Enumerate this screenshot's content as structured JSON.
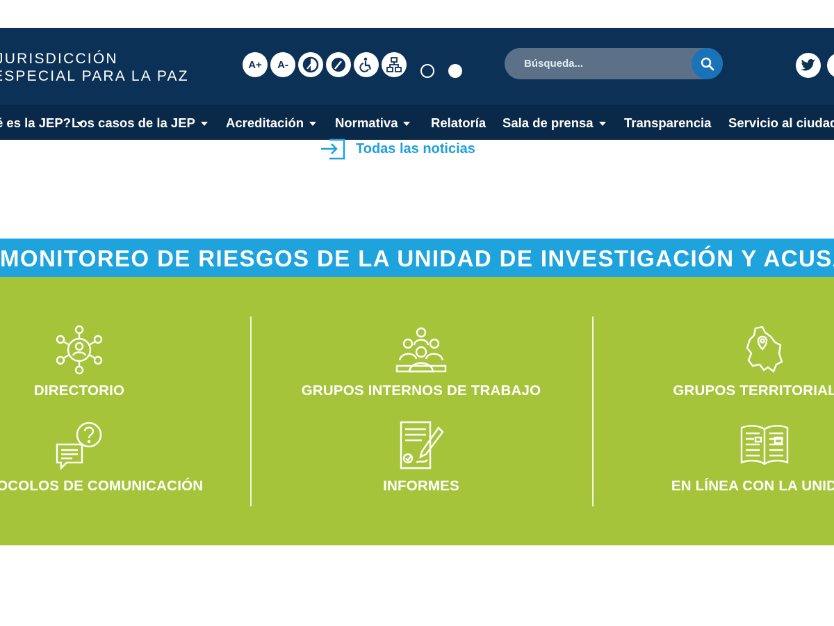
{
  "header": {
    "logo_line1": "JURISDICCIÓN",
    "logo_line2": "ESPECIAL PARA LA PAZ",
    "a11y": {
      "increase": "A+",
      "decrease": "A-"
    },
    "search_placeholder": "Búsqueda..."
  },
  "nav": {
    "items": [
      {
        "label": "¿Qué es la JEP?",
        "dropdown": true
      },
      {
        "label": "Los casos de la JEP",
        "dropdown": true
      },
      {
        "label": "Acreditación",
        "dropdown": true
      },
      {
        "label": "Normativa",
        "dropdown": true
      },
      {
        "label": "Relatoría",
        "dropdown": false
      },
      {
        "label": "Sala de prensa",
        "dropdown": true
      },
      {
        "label": "Transparencia",
        "dropdown": false
      },
      {
        "label": "Servicio al ciudadano",
        "dropdown": false
      }
    ]
  },
  "news_link": "Todas las noticias",
  "banner": {
    "title": "MONITOREO DE RIESGOS DE LA UNIDAD DE INVESTIGACIÓN Y ACUSACIÓN"
  },
  "tiles": [
    {
      "label": "DIRECTORIO",
      "icon": "network-person-icon"
    },
    {
      "label": "GRUPOS INTERNOS DE TRABAJO",
      "icon": "team-icon"
    },
    {
      "label": "GRUPOS TERRITORIALES",
      "icon": "map-pin-icon"
    },
    {
      "label": "PROTOCOLOS DE COMUNICACIÓN",
      "icon": "chat-question-icon"
    },
    {
      "label": "INFORMES",
      "icon": "document-pen-icon"
    },
    {
      "label": "EN LÍNEA CON LA UNIDAD",
      "icon": "open-book-icon"
    }
  ],
  "colors": {
    "header_bg": "#0c3157",
    "nav_bg": "#0a2848",
    "banner_bg": "#1ea3dd",
    "panel_bg": "#a5c43a",
    "link": "#1ea0db"
  }
}
